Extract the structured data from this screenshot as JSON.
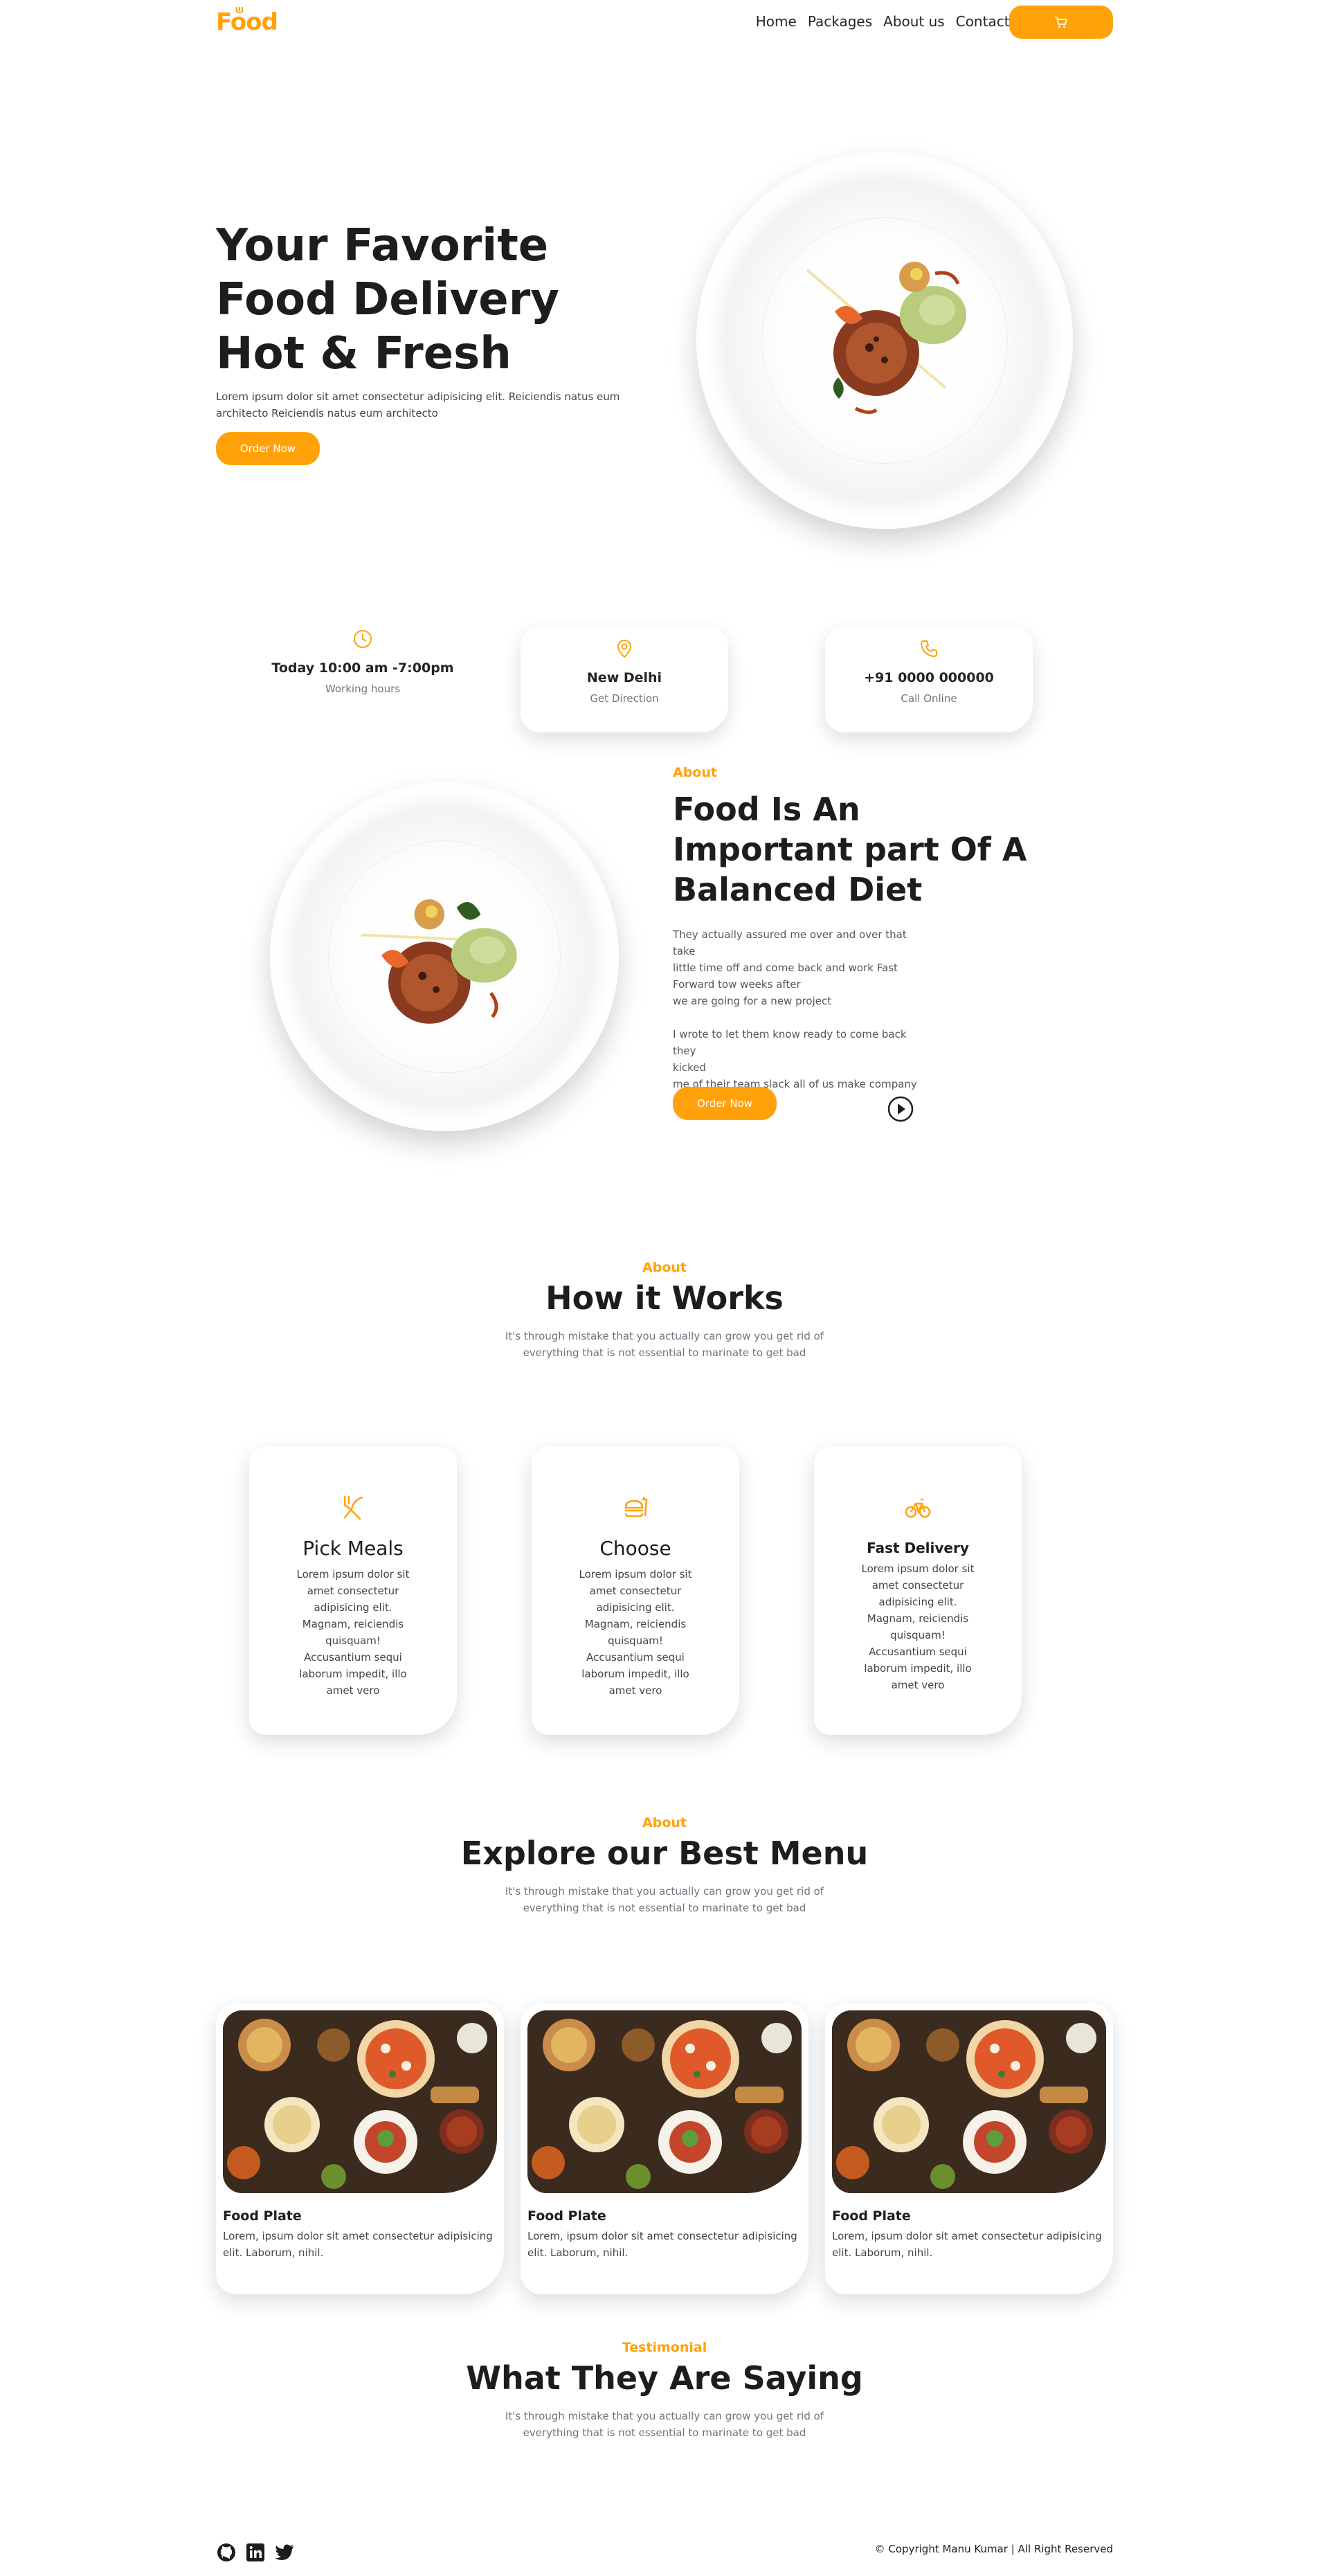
{
  "nav": {
    "logo": "Food",
    "links": [
      "Home",
      "Packages",
      "About us",
      "Contact us"
    ],
    "cart_icon": "cart-icon"
  },
  "hero": {
    "title": "Your Favorite Food Delivery Hot & Fresh",
    "text": "Lorem ipsum dolor sit amet consectetur adipisicing elit. Reiciendis natus eum architecto Reiciendis natus eum architecto",
    "button": "Order Now"
  },
  "info": [
    {
      "icon": "clock-icon",
      "title": "Today 10:00 am -7:00pm",
      "subtitle": "Working hours"
    },
    {
      "icon": "location-pin-icon",
      "title": "New Delhi",
      "subtitle": "Get Direction"
    },
    {
      "icon": "phone-icon",
      "title": "+91 0000 000000",
      "subtitle": "Call Online"
    }
  ],
  "about": {
    "label": "About",
    "title": "Food Is An Important part Of A Balanced Diet",
    "text": "They actually assured me over and over that take\nlittle time off and come back and work Fast\nForward tow weeks after\nwe are going for a new project\n\nI wrote to let them know ready to come back they\nkicked\nme of their team slack all of us make company\nemail.",
    "button": "Order Now",
    "play_icon": "play-icon"
  },
  "how": {
    "label": "About",
    "title": "How it Works",
    "subtitle": "It's through mistake that you actually can grow you get rid of everything that is not essential to marinate to get bad",
    "cards": [
      {
        "icon": "fork-knife-icon",
        "title": "Pick Meals",
        "text": "Lorem ipsum dolor sit amet consectetur adipisicing elit. Magnam, reiciendis quisquam! Accusantium sequi laborum impedit, illo amet vero"
      },
      {
        "icon": "burger-drink-icon",
        "title": "Choose",
        "text": "Lorem ipsum dolor sit amet consectetur adipisicing elit. Magnam, reiciendis quisquam! Accusantium sequi laborum impedit, illo amet vero"
      },
      {
        "icon": "bicycle-icon",
        "title": "Fast Delivery",
        "text": "Lorem ipsum dolor sit amet consectetur adipisicing elit. Magnam, reiciendis quisquam! Accusantium sequi laborum impedit, illo amet vero"
      }
    ]
  },
  "menu": {
    "label": "About",
    "title": "Explore our Best Menu",
    "subtitle": "It's through mistake that you actually can grow you get rid of everything that is not essential to marinate to get bad",
    "items": [
      {
        "title": "Food Plate",
        "text": "Lorem, ipsum dolor sit amet consectetur adipisicing elit. Laborum, nihil."
      },
      {
        "title": "Food Plate",
        "text": "Lorem, ipsum dolor sit amet consectetur adipisicing elit. Laborum, nihil."
      },
      {
        "title": "Food Plate",
        "text": "Lorem, ipsum dolor sit amet consectetur adipisicing elit. Laborum, nihil."
      }
    ]
  },
  "testimonial": {
    "label": "Testimonial",
    "title": "What They Are Saying",
    "subtitle": "It's through mistake that you actually can grow you get rid of everything that is not essential to marinate to get bad"
  },
  "footer": {
    "icons": [
      "github-icon",
      "linkedin-icon",
      "twitter-icon"
    ],
    "copyright": "© Copyright Manu Kumar | All Right Reserved"
  },
  "colors": {
    "accent": "#ffa20a",
    "text": "#1d1d1f",
    "muted": "#6c757d"
  }
}
